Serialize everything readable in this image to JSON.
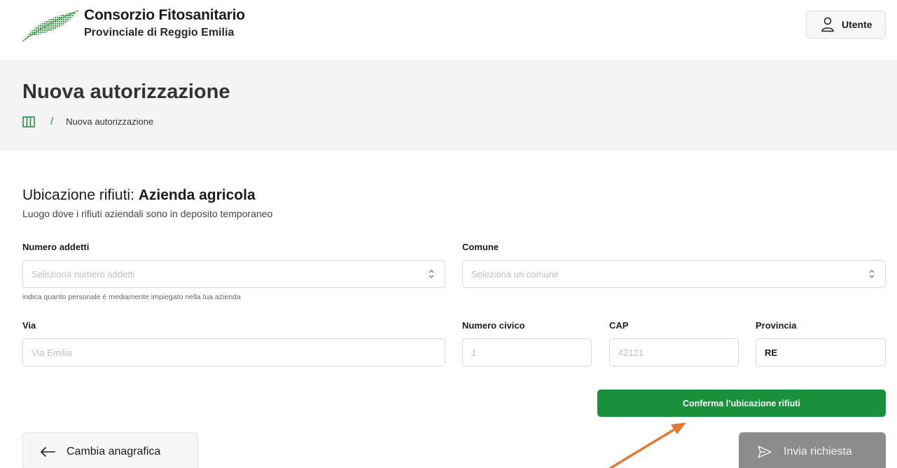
{
  "header": {
    "brand_title": "Consorzio Fitosanitario",
    "brand_subtitle": "Provinciale di Reggio Emilia",
    "user_label": "Utente",
    "logo_icon": "leaf-logo-icon",
    "user_icon": "user-icon"
  },
  "page": {
    "title": "Nuova autorizzazione",
    "breadcrumb": {
      "home_icon": "columns-icon",
      "separator": "/",
      "current": "Nuova autorizzazione"
    }
  },
  "section": {
    "title_prefix": "Ubicazione rifiuti: ",
    "title_bold": "Azienda agricola",
    "subtitle": "Luogo dove i rifiuti aziendali sono in deposito temporaneo"
  },
  "form": {
    "numero_addetti": {
      "label": "Numero addetti",
      "placeholder": "Seleziona numero addetti",
      "hint": "indica quanto personale è mediamente impiegato nella tua azienda"
    },
    "comune": {
      "label": "Comune",
      "placeholder": "Seleziona un comune"
    },
    "via": {
      "label": "Via",
      "placeholder": "Via Emilia"
    },
    "numero_civico": {
      "label": "Numero civico",
      "placeholder": "1"
    },
    "cap": {
      "label": "CAP",
      "placeholder": "42121"
    },
    "provincia": {
      "label": "Provincia",
      "value": "RE"
    }
  },
  "actions": {
    "confirm_label": "Conferma l’ubicazione rifiuti",
    "back_label": "Cambia anagrafica",
    "send_label": "Invia richiesta"
  },
  "colors": {
    "accent_green": "#1a8f3c",
    "disabled_grey": "#8c8c8c",
    "annotation_arrow": "#e07a35"
  }
}
